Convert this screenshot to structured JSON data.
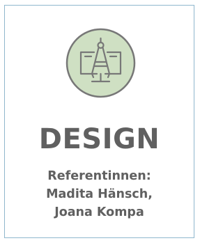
{
  "icon": "drafting-compass-on-monitor-icon",
  "colors": {
    "badge_fill": "#cfe0c3",
    "badge_stroke": "#777777",
    "text": "#606060",
    "border": "#8fb7cd"
  },
  "title": "DESIGN",
  "speakers": {
    "label": "Referentinnen:",
    "line1": "Madita Hänsch,",
    "line2": "Joana Kompa"
  }
}
